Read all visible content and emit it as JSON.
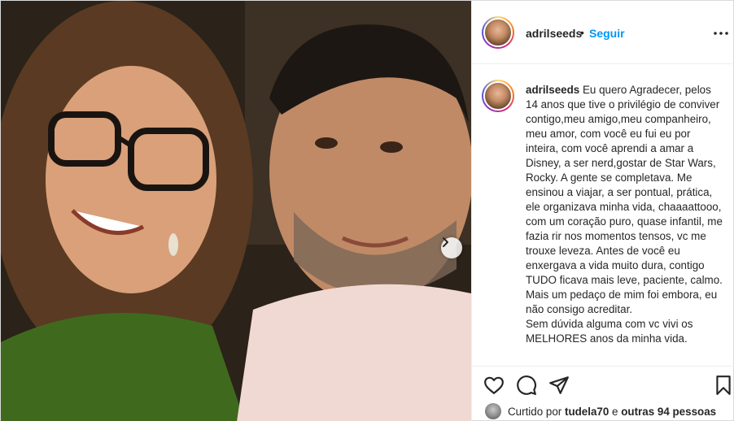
{
  "post": {
    "username": "adrilseeds",
    "separator": "•",
    "follow_label": "Seguir",
    "more_icon": "more-horizontal-icon",
    "photo_alt": "",
    "caption": {
      "username": "adrilseeds",
      "text": "Eu quero Agradecer, pelos 14 anos que tive o privilégio de conviver contigo,meu amigo,meu companheiro, meu amor, com você eu fui eu por inteira, com você aprendi a amar a Disney, a ser nerd,gostar de Star Wars, Rocky. A gente se completava. Me ensinou a viajar, a ser pontual, prática, ele organizava minha vida, chaaaattooo, com um coração puro, quase infantil, me fazia rir nos momentos tensos, vc me trouxe leveza. Antes de você eu enxergava a vida muito dura, contigo TUDO ficava mais leve, paciente, calmo. Mais um pedaço de mim foi embora, eu não consigo acreditar.\nSem dúvida alguma com vc vivi os MELHORES anos da minha vida."
    },
    "actions": {
      "like_icon": "heart-icon",
      "comment_icon": "comment-icon",
      "share_icon": "send-icon",
      "save_icon": "bookmark-icon"
    },
    "likes": {
      "prefix": "Curtido por",
      "liker": "tudela70",
      "connector": "e",
      "others": "outras 94 pessoas"
    },
    "colors": {
      "link_blue": "#0095f6",
      "text": "#262626",
      "border": "#dbdbdb"
    }
  }
}
